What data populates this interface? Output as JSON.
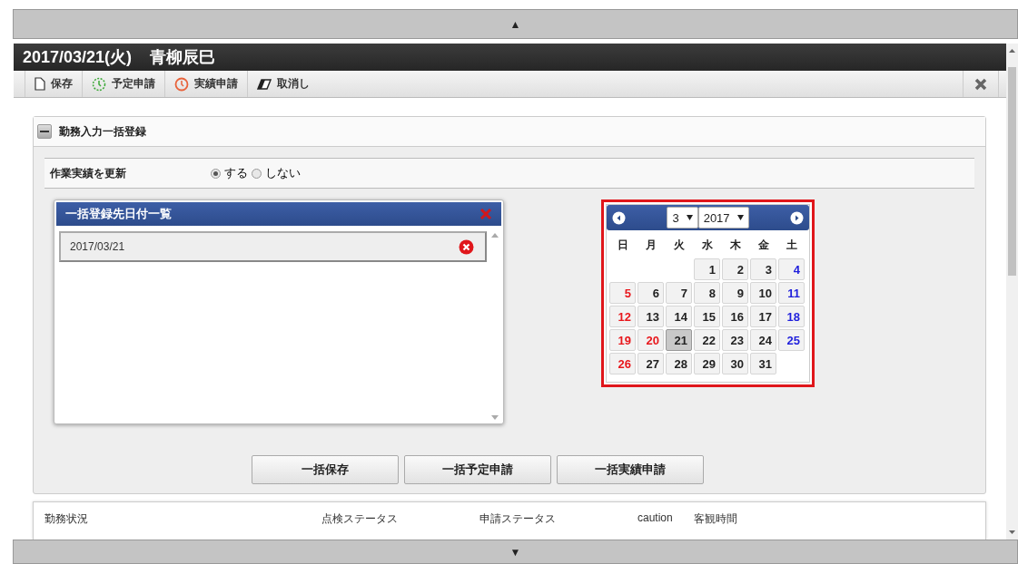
{
  "top_scroll": {
    "arrow": "▲"
  },
  "window": {
    "title_date": "2017/03/21(火)",
    "title_name": "青柳辰巳"
  },
  "toolbar": [
    {
      "label": "保存",
      "kind": "document"
    },
    {
      "label": "予定申請",
      "kind": "plan"
    },
    {
      "label": "実績申請",
      "kind": "actual"
    },
    {
      "label": "取消し",
      "kind": "eraser"
    }
  ],
  "section": {
    "title": "勤務入力一括登録",
    "expanded": true,
    "setting": {
      "label": "作業実績を更新",
      "options": [
        {
          "label": "する",
          "selected": true
        },
        {
          "label": "しない",
          "selected": false
        }
      ]
    },
    "date_list": {
      "title": "一括登録先日付一覧",
      "items": [
        "2017/03/21"
      ]
    },
    "calendar": {
      "month": "3",
      "year": "2017",
      "weekdays": [
        "日",
        "月",
        "火",
        "水",
        "木",
        "金",
        "土"
      ],
      "weeks": [
        [
          {
            "kind": "blank"
          },
          {
            "kind": "blank"
          },
          {
            "kind": "blank"
          },
          {
            "day": "1",
            "kind": "weekday",
            "selected": false
          },
          {
            "day": "2",
            "kind": "weekday",
            "selected": false
          },
          {
            "day": "3",
            "kind": "weekday",
            "selected": false
          },
          {
            "day": "4",
            "kind": "saturday",
            "selected": false
          }
        ],
        [
          {
            "day": "5",
            "kind": "sunday",
            "selected": false
          },
          {
            "day": "6",
            "kind": "weekday",
            "selected": false
          },
          {
            "day": "7",
            "kind": "weekday",
            "selected": false
          },
          {
            "day": "8",
            "kind": "weekday",
            "selected": false
          },
          {
            "day": "9",
            "kind": "weekday",
            "selected": false
          },
          {
            "day": "10",
            "kind": "weekday",
            "selected": false
          },
          {
            "day": "11",
            "kind": "saturday",
            "selected": false
          }
        ],
        [
          {
            "day": "12",
            "kind": "sunday",
            "selected": false
          },
          {
            "day": "13",
            "kind": "weekday",
            "selected": false
          },
          {
            "day": "14",
            "kind": "weekday",
            "selected": false
          },
          {
            "day": "15",
            "kind": "weekday",
            "selected": false
          },
          {
            "day": "16",
            "kind": "weekday",
            "selected": false
          },
          {
            "day": "17",
            "kind": "weekday",
            "selected": false
          },
          {
            "day": "18",
            "kind": "saturday",
            "selected": false
          }
        ],
        [
          {
            "day": "19",
            "kind": "sunday",
            "selected": false
          },
          {
            "day": "20",
            "kind": "holiday",
            "selected": false
          },
          {
            "day": "21",
            "kind": "weekday",
            "selected": true
          },
          {
            "day": "22",
            "kind": "weekday",
            "selected": false
          },
          {
            "day": "23",
            "kind": "weekday",
            "selected": false
          },
          {
            "day": "24",
            "kind": "weekday",
            "selected": false
          },
          {
            "day": "25",
            "kind": "saturday",
            "selected": false
          }
        ],
        [
          {
            "day": "26",
            "kind": "sunday",
            "selected": false
          },
          {
            "day": "27",
            "kind": "weekday",
            "selected": false
          },
          {
            "day": "28",
            "kind": "weekday",
            "selected": false
          },
          {
            "day": "29",
            "kind": "weekday",
            "selected": false
          },
          {
            "day": "30",
            "kind": "weekday",
            "selected": false
          },
          {
            "day": "31",
            "kind": "weekday",
            "selected": false
          },
          {
            "kind": "blank"
          }
        ]
      ]
    },
    "buttons": [
      "一括保存",
      "一括予定申請",
      "一括実績申請"
    ]
  },
  "table": {
    "columns": [
      "勤務状況",
      "点検ステータス",
      "申請ステータス",
      "caution",
      "客観時間"
    ]
  },
  "bottom_scroll": {
    "arrow": "▼"
  }
}
